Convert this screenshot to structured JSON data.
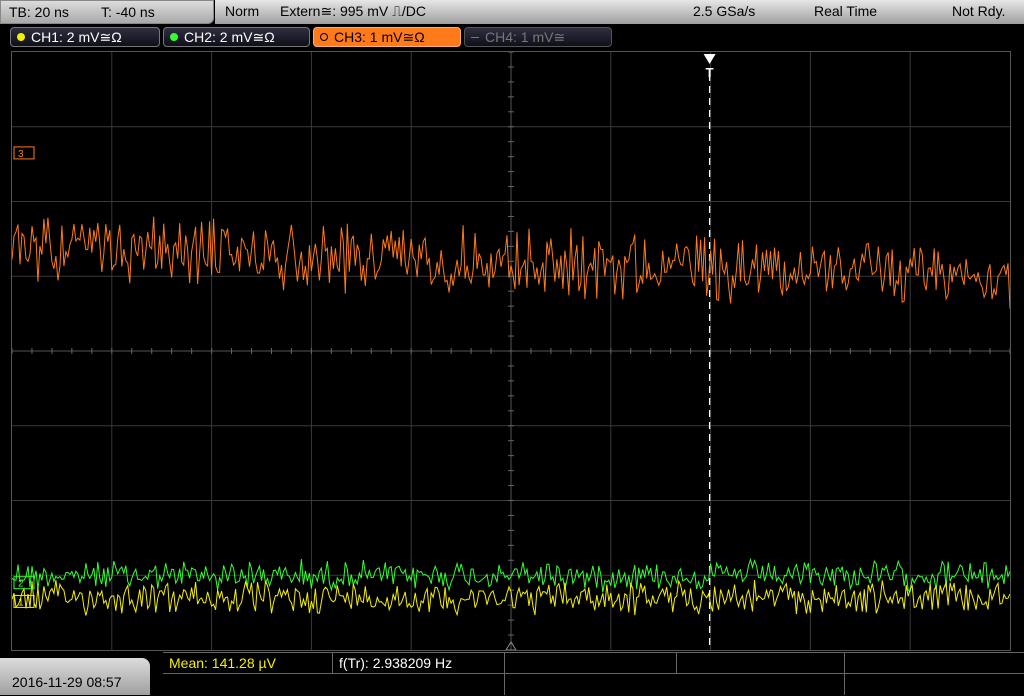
{
  "timebase": {
    "tb": "TB: 20 ns",
    "t": "T: -40 ns"
  },
  "trigger": {
    "mode": "Norm",
    "source": "Extern≅: 995 mV ⎍/DC",
    "sample_rate": "2.5 GSa/s",
    "acq_mode": "Real Time",
    "status": "Not Rdy."
  },
  "channels": [
    {
      "label": "CH1: 2 mV≅Ω",
      "color": "#f5f000",
      "state": "on"
    },
    {
      "label": "CH2: 2 mV≅Ω",
      "color": "#33ff33",
      "state": "on"
    },
    {
      "label": "CH3: 1 mV≅Ω",
      "color": "#ff7a1a",
      "state": "active"
    },
    {
      "label": "CH4: 1 mV≅",
      "color": "#777777",
      "state": "off"
    }
  ],
  "waveforms": {
    "ch3": {
      "color": "#ff7a1a",
      "level_div": 2.6,
      "noise_div": 0.45
    },
    "ch2": {
      "color": "#33ff33",
      "level_div": 7.0,
      "noise_div": 0.2
    },
    "ch1": {
      "color": "#f5f000",
      "level_div": 7.3,
      "noise_div": 0.22
    }
  },
  "markers": {
    "ch1": "1",
    "ch2": "2",
    "ch3": "3",
    "trigger": "T"
  },
  "measurement": {
    "mean": "Mean: 141.28 µV",
    "freq": "f(Tr): 2.938209 Hz"
  },
  "datetime": "2016-11-29 08:57"
}
